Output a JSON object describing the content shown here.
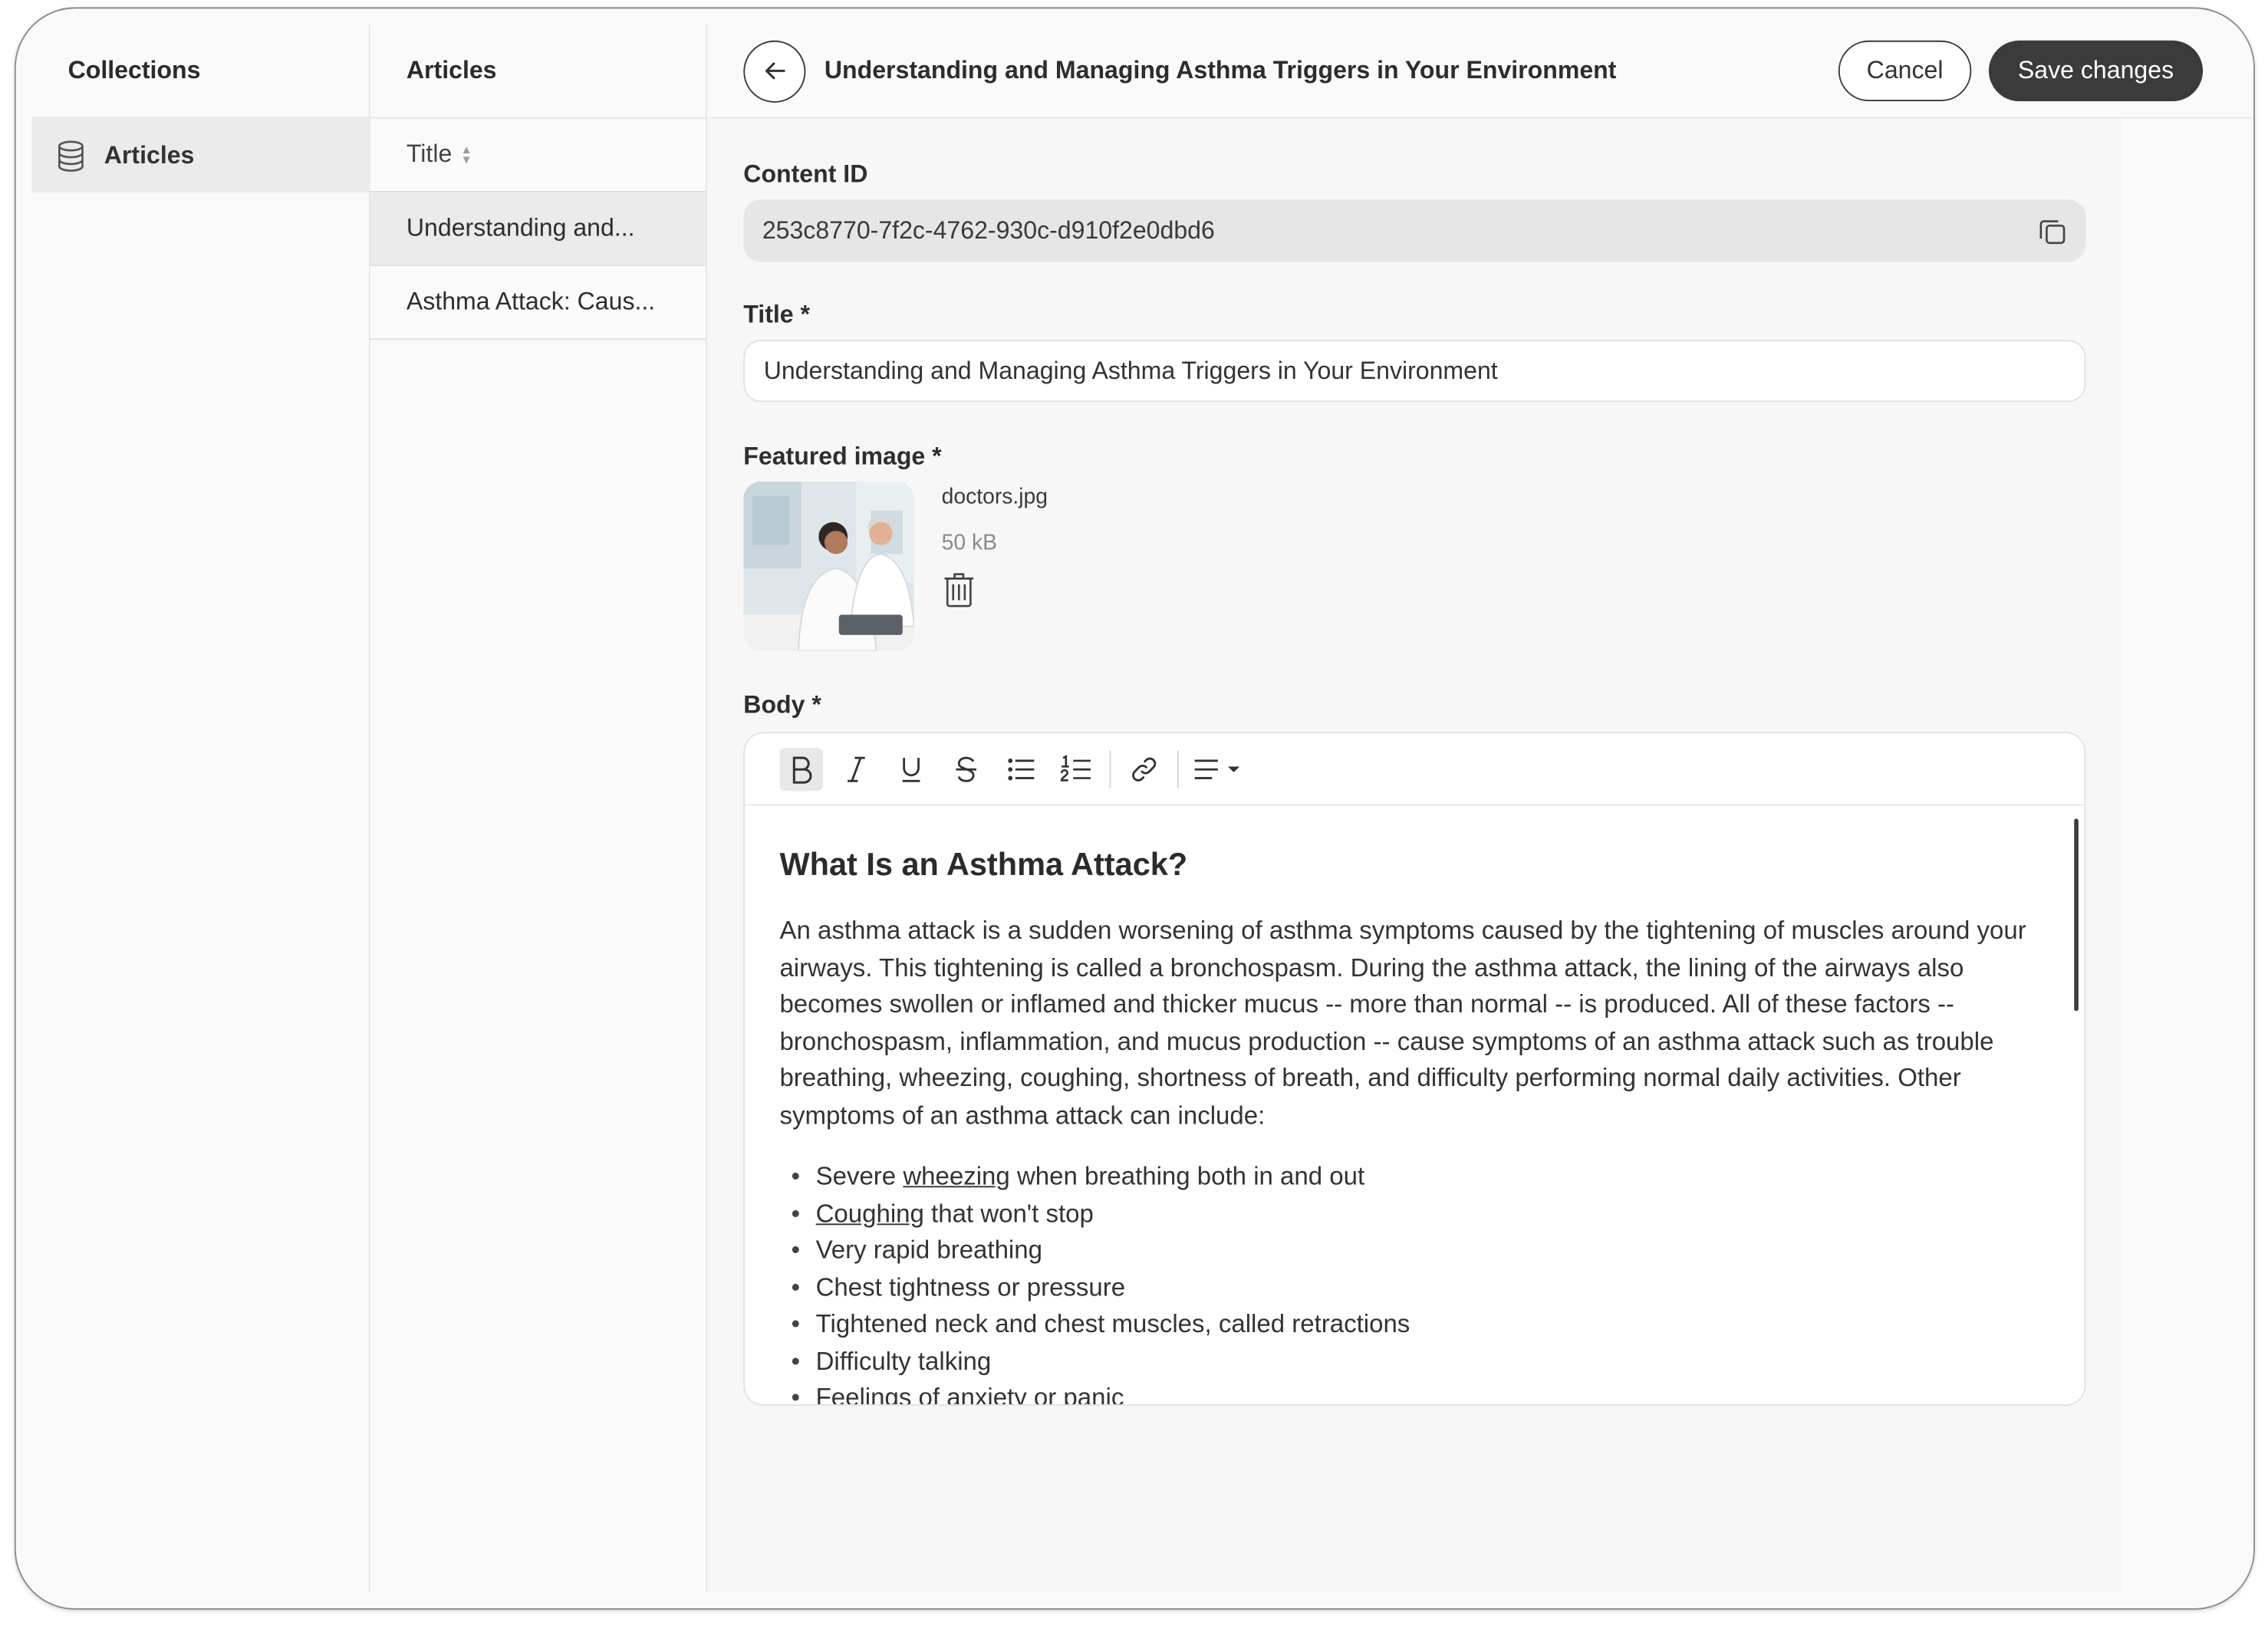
{
  "collections": {
    "header": "Collections",
    "items": [
      {
        "label": "Articles",
        "icon": "database-icon"
      }
    ]
  },
  "articles": {
    "header": "Articles",
    "sort_label": "Title",
    "rows": [
      {
        "title": "Understanding and..."
      },
      {
        "title": "Asthma Attack: Caus..."
      }
    ]
  },
  "editor": {
    "title": "Understanding and Managing Asthma Triggers in Your Environment",
    "cancel_label": "Cancel",
    "save_label": "Save changes",
    "content_id_label": "Content ID",
    "content_id_value": "253c8770-7f2c-4762-930c-d910f2e0dbd6",
    "title_label": "Title *",
    "title_value": "Understanding and Managing Asthma Triggers in Your Environment",
    "image_label": "Featured image *",
    "image_file_name": "doctors.jpg",
    "image_file_size": "50 kB",
    "body_label": "Body *",
    "body": {
      "heading": "What Is an Asthma Attack?",
      "paragraph": "An asthma attack is a sudden worsening of asthma symptoms caused by the tightening of muscles around your airways. This tightening is called a bronchospasm. During the asthma attack, the lining of the airways also becomes swollen or inflamed and thicker mucus -- more than normal -- is produced. All of these factors -- bronchospasm, inflammation, and mucus production -- cause symptoms of an asthma attack such as trouble breathing, wheezing, coughing, shortness of breath, and difficulty performing normal daily activities. Other symptoms of an asthma attack can include:",
      "list": {
        "item1_pre": "Severe ",
        "item1_link": "wheezing",
        "item1_post": " when breathing both in and out",
        "item2_link": "Coughing",
        "item2_post": " that won't stop",
        "item3": "Very rapid breathing",
        "item4": "Chest tightness or pressure",
        "item5": "Tightened neck and chest muscles, called retractions",
        "item6": "Difficulty talking",
        "item7": "Feelings of anxiety or panic"
      }
    }
  }
}
